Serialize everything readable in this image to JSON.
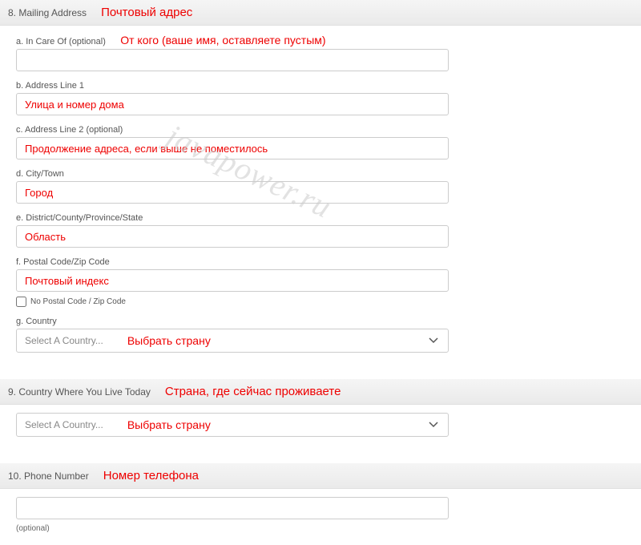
{
  "watermark": "javapower.ru",
  "section8": {
    "title": "8. Mailing Address",
    "annotation": "Почтовый адрес",
    "fields": {
      "a": {
        "label": "a. In Care Of (optional)",
        "annotation": "От кого (ваше имя, оставляете пустым)",
        "value": ""
      },
      "b": {
        "label": "b. Address Line 1",
        "value": "Улица и номер дома"
      },
      "c": {
        "label": "c. Address Line 2 (optional)",
        "value": "Продолжение адреса, если выше не поместилось"
      },
      "d": {
        "label": "d. City/Town",
        "value": "Город"
      },
      "e": {
        "label": "e. District/County/Province/State",
        "value": "Область"
      },
      "f": {
        "label": "f. Postal Code/Zip Code",
        "value": "Почтовый индекс"
      },
      "noPostal": "No Postal Code / Zip Code",
      "g": {
        "label": "g. Country",
        "placeholder": "Select A Country...",
        "annotation": "Выбрать страну"
      }
    }
  },
  "section9": {
    "title": "9. Country Where You Live Today",
    "annotation": "Страна, где сейчас проживаете",
    "placeholder": "Select A Country...",
    "selectAnnotation": "Выбрать страну"
  },
  "section10": {
    "title": "10. Phone Number",
    "annotation": "Номер телефона",
    "optional": "(optional)",
    "value": ""
  }
}
